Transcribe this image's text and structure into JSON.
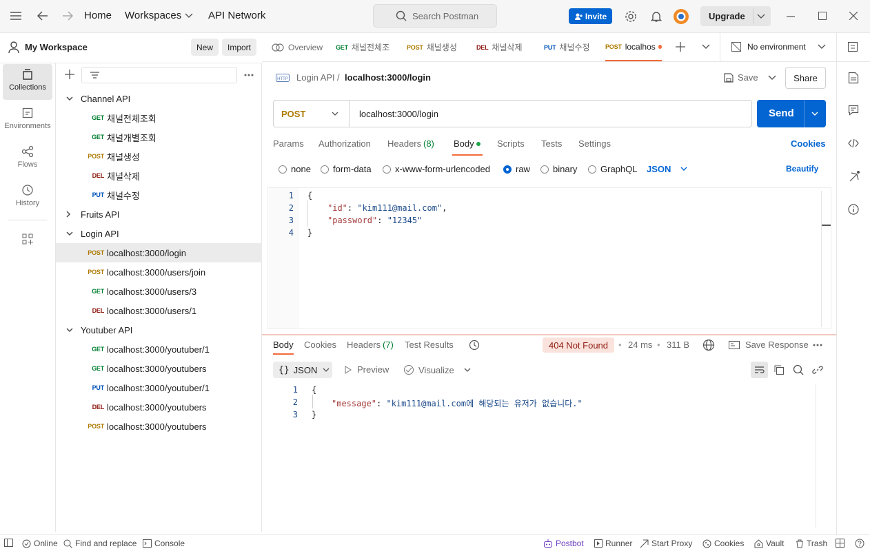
{
  "topbar": {
    "nav": [
      "Home",
      "Workspaces",
      "API Network"
    ],
    "search_placeholder": "Search Postman",
    "invite_label": "Invite",
    "upgrade_label": "Upgrade"
  },
  "workspace": {
    "name": "My Workspace",
    "new_label": "New",
    "import_label": "Import"
  },
  "iconbar": [
    {
      "label": "Collections",
      "icon": "collections-icon"
    },
    {
      "label": "Environments",
      "icon": "environments-icon"
    },
    {
      "label": "Flows",
      "icon": "flows-icon"
    },
    {
      "label": "History",
      "icon": "history-icon"
    }
  ],
  "tree": [
    {
      "type": "folder",
      "label": "Channel API",
      "expanded": true
    },
    {
      "type": "request",
      "method": "GET",
      "label": "채널전체조회"
    },
    {
      "type": "request",
      "method": "GET",
      "label": "채널개별조회"
    },
    {
      "type": "request",
      "method": "POST",
      "label": "채널생성"
    },
    {
      "type": "request",
      "method": "DEL",
      "label": "채널삭제"
    },
    {
      "type": "request",
      "method": "PUT",
      "label": "채널수정"
    },
    {
      "type": "folder",
      "label": "Fruits API",
      "expanded": false
    },
    {
      "type": "folder",
      "label": "Login API",
      "expanded": true
    },
    {
      "type": "request",
      "method": "POST",
      "label": "localhost:3000/login",
      "selected": true
    },
    {
      "type": "request",
      "method": "POST",
      "label": "localhost:3000/users/join"
    },
    {
      "type": "request",
      "method": "GET",
      "label": "localhost:3000/users/3"
    },
    {
      "type": "request",
      "method": "DEL",
      "label": "localhost:3000/users/1"
    },
    {
      "type": "folder",
      "label": "Youtuber API",
      "expanded": true
    },
    {
      "type": "request",
      "method": "GET",
      "label": "localhost:3000/youtuber/1"
    },
    {
      "type": "request",
      "method": "GET",
      "label": "localhost:3000/youtubers"
    },
    {
      "type": "request",
      "method": "PUT",
      "label": "localhost:3000/youtuber/1"
    },
    {
      "type": "request",
      "method": "DEL",
      "label": "localhost:3000/youtubers"
    },
    {
      "type": "request",
      "method": "POST",
      "label": "localhost:3000/youtubers"
    }
  ],
  "tabs": {
    "overview": "Overview",
    "items": [
      {
        "method": "GET",
        "label": "채널전체조"
      },
      {
        "method": "POST",
        "label": "채널생성"
      },
      {
        "method": "DEL",
        "label": "채널삭제"
      },
      {
        "method": "PUT",
        "label": "채널수정"
      },
      {
        "method": "POST",
        "label": "localhos"
      }
    ],
    "environment": "No environment"
  },
  "request": {
    "breadcrumb_collection": "Login API",
    "breadcrumb_sep": "/",
    "breadcrumb_name": "localhost:3000/login",
    "save_label": "Save",
    "share_label": "Share",
    "method": "POST",
    "url": "localhost:3000/login",
    "send_label": "Send",
    "subtabs": [
      "Params",
      "Authorization",
      "Headers",
      "(8)",
      "Body",
      "Scripts",
      "Tests",
      "Settings"
    ],
    "cookies_label": "Cookies",
    "body_types": [
      "none",
      "form-data",
      "x-www-form-urlencoded",
      "raw",
      "binary",
      "GraphQL"
    ],
    "body_selected": "raw",
    "format": "JSON",
    "beautify_label": "Beautify",
    "lines": [
      "1",
      "2",
      "3",
      "4"
    ],
    "code": {
      "l1": "{",
      "k_id": "\"id\"",
      "v_id": "\"kim111@mail.com\"",
      "k_pw": "\"password\"",
      "v_pw": "\"12345\"",
      "l4": "}"
    }
  },
  "response": {
    "tabs": [
      "Body",
      "Cookies",
      "Headers",
      "(7)",
      "Test Results"
    ],
    "status": "404 Not Found",
    "time": "24 ms",
    "size": "311 B",
    "save_response_label": "Save Response",
    "format": "JSON",
    "preview_label": "Preview",
    "visualize_label": "Visualize",
    "lines": [
      "1",
      "2",
      "3"
    ],
    "code": {
      "l1": "{",
      "key": "\"message\"",
      "val": "\"kim111@mail.com에 해당되는 유저가 없습니다.\"",
      "l3": "}"
    }
  },
  "statusbar": {
    "online": "Online",
    "find_replace": "Find and replace",
    "console": "Console",
    "postbot": "Postbot",
    "runner": "Runner",
    "start_proxy": "Start Proxy",
    "cookies": "Cookies",
    "vault": "Vault",
    "trash": "Trash"
  },
  "colors": {
    "accent": "#0265d2",
    "get": "#007f31",
    "post": "#ad7a03",
    "del": "#8e1a10",
    "put": "#0053b8",
    "error": "#8e1a10"
  }
}
